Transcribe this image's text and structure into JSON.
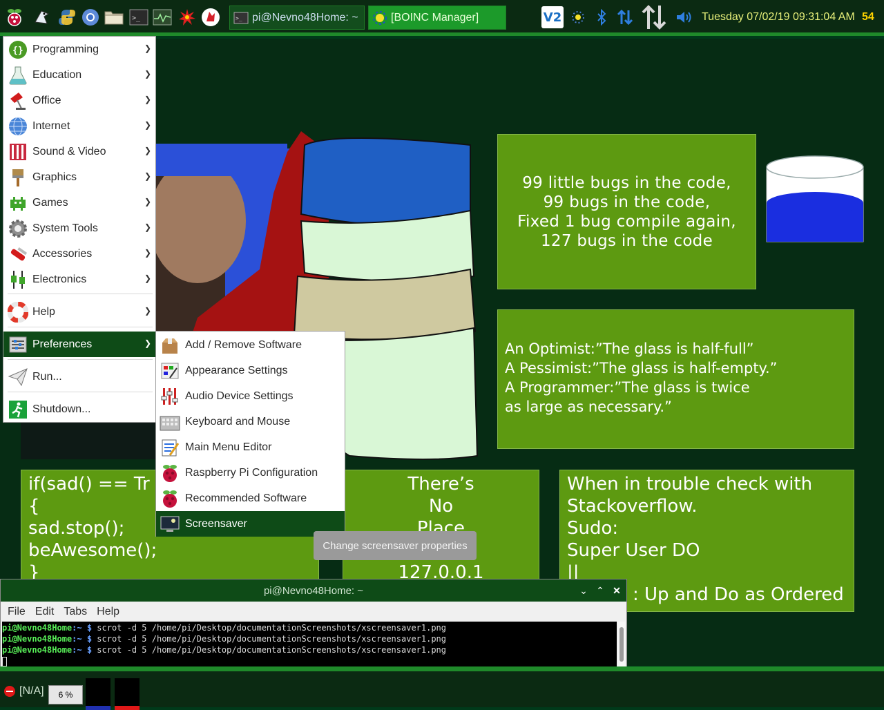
{
  "top_panel": {
    "launchers": [
      "raspberry-menu-icon",
      "file-manager-bird-icon",
      "python-icon",
      "chromium-icon",
      "folder-icon",
      "terminal-icon",
      "cpu-monitor-icon",
      "star-burst-icon",
      "mathematica-icon"
    ],
    "tasks": [
      {
        "label": "pi@Nevno48Home: ~",
        "icon": "terminal-icon"
      },
      {
        "label": "[BOINC Manager]",
        "icon": "boinc-icon"
      }
    ],
    "tray": [
      "vnc-icon",
      "boinc-tray-icon",
      "bluetooth-icon",
      "network-icon",
      "updown-arrow-icon",
      "volume-icon"
    ],
    "vnc_label": "V2",
    "clock": "Tuesday 07/02/19 09:31:04 AM",
    "cpu": "54"
  },
  "desktop": {
    "bugs_card": [
      "99 little bugs in the code,",
      "99 bugs in the code,",
      "Fixed 1 bug compile again,",
      "127 bugs in the code"
    ],
    "glass_card": [
      "An Optimist:”The glass is half-full”",
      "A Pessimist:”The glass is half-empty.”",
      "A Programmer:”The glass is twice",
      "as large as necessary.”"
    ],
    "code_card": [
      "if(sad() == Tr",
      "{",
      "sad.stop();",
      "beAwesome();",
      "}"
    ],
    "home_card": [
      "There’s",
      "No",
      "Place",
      "",
      "127.0.0.1"
    ],
    "sudo_card": [
      "When in trouble check with",
      "Stackoverflow.",
      "Sudo:",
      "Super User DO",
      "||",
      ": Up and Do as Ordered"
    ]
  },
  "main_menu": {
    "items": [
      {
        "label": "Programming",
        "icon": "programming-icon"
      },
      {
        "label": "Education",
        "icon": "education-flask-icon"
      },
      {
        "label": "Office",
        "icon": "office-lamp-icon"
      },
      {
        "label": "Internet",
        "icon": "internet-globe-icon"
      },
      {
        "label": "Sound & Video",
        "icon": "sound-video-icon"
      },
      {
        "label": "Graphics",
        "icon": "graphics-brush-icon"
      },
      {
        "label": "Games",
        "icon": "games-invader-icon"
      },
      {
        "label": "System Tools",
        "icon": "system-tools-gear-icon"
      },
      {
        "label": "Accessories",
        "icon": "accessories-knife-icon"
      },
      {
        "label": "Electronics",
        "icon": "electronics-icon"
      },
      {
        "label": "Help",
        "icon": "help-lifebuoy-icon"
      },
      {
        "label": "Preferences",
        "icon": "preferences-icon"
      },
      {
        "label": "Run...",
        "icon": "run-paperplane-icon"
      },
      {
        "label": "Shutdown...",
        "icon": "shutdown-exit-icon"
      }
    ],
    "active": "Preferences"
  },
  "pref_menu": {
    "items": [
      {
        "label": "Add / Remove Software",
        "icon": "add-remove-software-icon"
      },
      {
        "label": "Appearance Settings",
        "icon": "appearance-settings-icon"
      },
      {
        "label": "Audio Device Settings",
        "icon": "audio-device-settings-icon"
      },
      {
        "label": "Keyboard and Mouse",
        "icon": "keyboard-mouse-icon"
      },
      {
        "label": "Main Menu Editor",
        "icon": "menu-editor-icon"
      },
      {
        "label": "Raspberry Pi Configuration",
        "icon": "raspberry-config-icon"
      },
      {
        "label": "Recommended Software",
        "icon": "recommended-software-icon"
      },
      {
        "label": "Screensaver",
        "icon": "screensaver-icon"
      }
    ],
    "active": "Screensaver"
  },
  "tooltip": "Change screensaver properties",
  "terminal": {
    "title": "pi@Nevno48Home: ~",
    "menus": [
      "File",
      "Edit",
      "Tabs",
      "Help"
    ],
    "lines": [
      {
        "prompt": "pi@Nevno48Home",
        "path": ":~ $",
        "cmd": " scrot -d 5 /home/pi/Desktop/documentationScreenshots/xscreensaver1.png"
      },
      {
        "prompt": "pi@Nevno48Home",
        "path": ":~ $",
        "cmd": " scrot -d 5 /home/pi/Desktop/documentationScreenshots/xscreensaver1.png"
      },
      {
        "prompt": "pi@Nevno48Home",
        "path": ":~ $",
        "cmd": " scrot -d 5 /home/pi/Desktop/documentationScreenshots/xscreensaver1.png"
      }
    ]
  },
  "bottom_panel": {
    "battery": "[N/A]",
    "volume": "6 %"
  },
  "colors": {
    "panel": "#0b2a12",
    "panel_accent": "#1f8a2a",
    "menu_highlight": "#0e4b17",
    "card": "#5d9a11",
    "clock": "#e8f07a"
  }
}
